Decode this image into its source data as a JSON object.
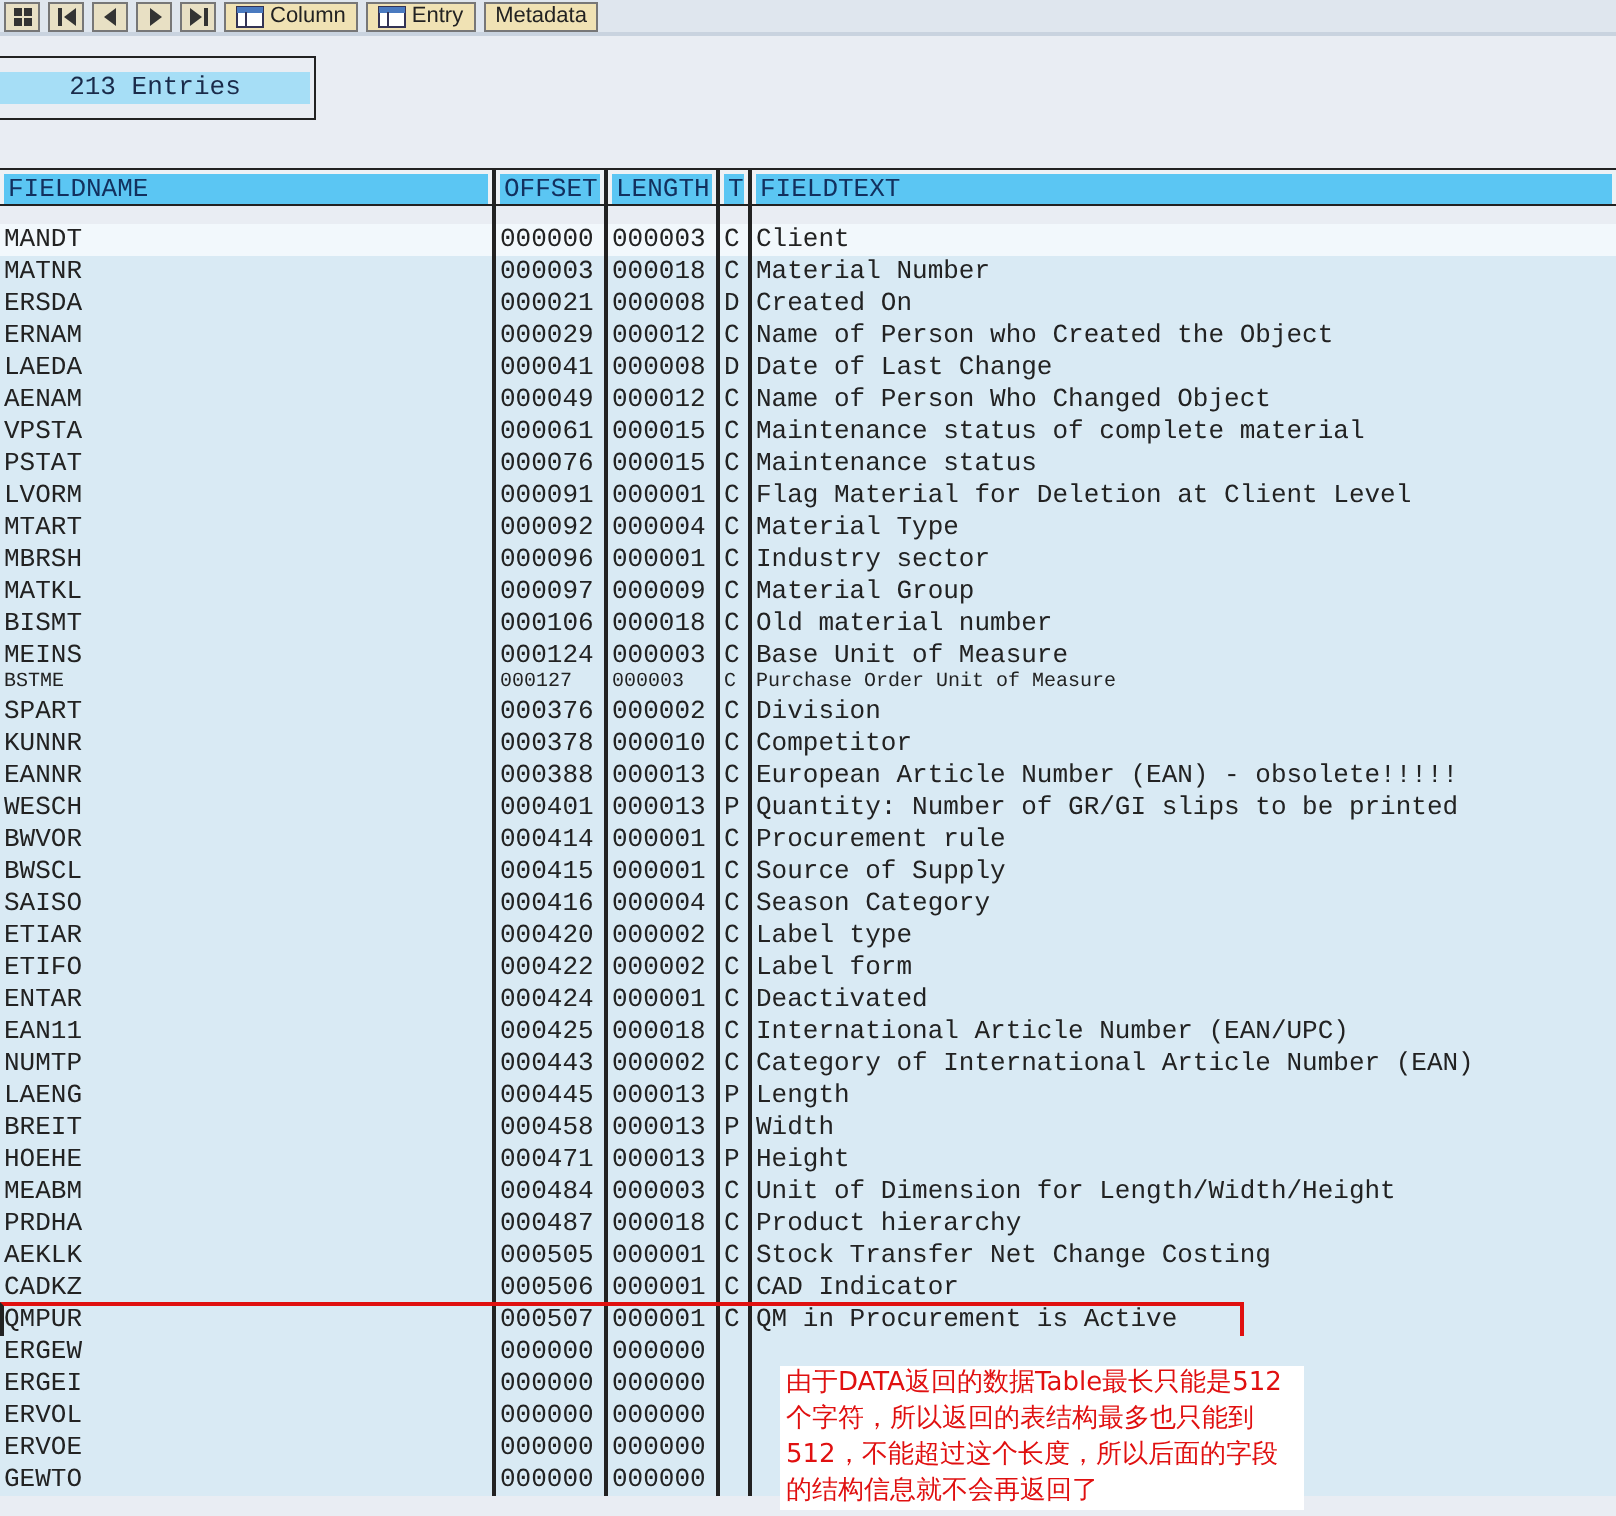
{
  "toolbar": {
    "nav_buttons": [
      {
        "kind": "grid"
      },
      {
        "kind": "first"
      },
      {
        "kind": "prev"
      },
      {
        "kind": "next"
      },
      {
        "kind": "last"
      }
    ],
    "buttons": [
      {
        "label": "Column",
        "icon": true
      },
      {
        "label": "Entry",
        "icon": true
      },
      {
        "label": "Metadata",
        "icon": false
      }
    ]
  },
  "entries_count": "213 Entries",
  "table": {
    "columns": [
      "FIELDNAME",
      "OFFSET",
      "LENGTH",
      "T",
      "FIELDTEXT"
    ],
    "rows": [
      {
        "cells": [
          "MANDT",
          "000000",
          "000003",
          "C",
          "Client"
        ],
        "selected": true,
        "highlighted": false,
        "clipped": false
      },
      {
        "cells": [
          "MATNR",
          "000003",
          "000018",
          "C",
          "Material Number"
        ],
        "selected": false,
        "highlighted": false,
        "clipped": false
      },
      {
        "cells": [
          "ERSDA",
          "000021",
          "000008",
          "D",
          "Created On"
        ],
        "selected": false,
        "highlighted": false,
        "clipped": false
      },
      {
        "cells": [
          "ERNAM",
          "000029",
          "000012",
          "C",
          "Name of Person who Created the Object"
        ],
        "selected": false,
        "highlighted": false,
        "clipped": false
      },
      {
        "cells": [
          "LAEDA",
          "000041",
          "000008",
          "D",
          "Date of Last Change"
        ],
        "selected": false,
        "highlighted": false,
        "clipped": false
      },
      {
        "cells": [
          "AENAM",
          "000049",
          "000012",
          "C",
          "Name of Person Who Changed Object"
        ],
        "selected": false,
        "highlighted": false,
        "clipped": false
      },
      {
        "cells": [
          "VPSTA",
          "000061",
          "000015",
          "C",
          "Maintenance status of complete material"
        ],
        "selected": false,
        "highlighted": false,
        "clipped": false
      },
      {
        "cells": [
          "PSTAT",
          "000076",
          "000015",
          "C",
          "Maintenance status"
        ],
        "selected": false,
        "highlighted": false,
        "clipped": false
      },
      {
        "cells": [
          "LVORM",
          "000091",
          "000001",
          "C",
          "Flag Material for Deletion at Client Level"
        ],
        "selected": false,
        "highlighted": false,
        "clipped": false
      },
      {
        "cells": [
          "MTART",
          "000092",
          "000004",
          "C",
          "Material Type"
        ],
        "selected": false,
        "highlighted": false,
        "clipped": false
      },
      {
        "cells": [
          "MBRSH",
          "000096",
          "000001",
          "C",
          "Industry sector"
        ],
        "selected": false,
        "highlighted": false,
        "clipped": false
      },
      {
        "cells": [
          "MATKL",
          "000097",
          "000009",
          "C",
          "Material Group"
        ],
        "selected": false,
        "highlighted": false,
        "clipped": false
      },
      {
        "cells": [
          "BISMT",
          "000106",
          "000018",
          "C",
          "Old material number"
        ],
        "selected": false,
        "highlighted": false,
        "clipped": false
      },
      {
        "cells": [
          "MEINS",
          "000124",
          "000003",
          "C",
          "Base Unit of Measure"
        ],
        "selected": false,
        "highlighted": false,
        "clipped": false
      },
      {
        "cells": [
          "BSTME",
          "000127",
          "000003",
          "C",
          "Purchase Order Unit of Measure"
        ],
        "selected": false,
        "highlighted": false,
        "clipped": true
      },
      {
        "cells": [
          "SPART",
          "000376",
          "000002",
          "C",
          "Division"
        ],
        "selected": false,
        "highlighted": false,
        "clipped": false
      },
      {
        "cells": [
          "KUNNR",
          "000378",
          "000010",
          "C",
          "Competitor"
        ],
        "selected": false,
        "highlighted": false,
        "clipped": false
      },
      {
        "cells": [
          "EANNR",
          "000388",
          "000013",
          "C",
          "European Article Number (EAN) - obsolete!!!!!"
        ],
        "selected": false,
        "highlighted": false,
        "clipped": false
      },
      {
        "cells": [
          "WESCH",
          "000401",
          "000013",
          "P",
          "Quantity: Number of GR/GI slips to be printed"
        ],
        "selected": false,
        "highlighted": false,
        "clipped": false
      },
      {
        "cells": [
          "BWVOR",
          "000414",
          "000001",
          "C",
          "Procurement rule"
        ],
        "selected": false,
        "highlighted": false,
        "clipped": false
      },
      {
        "cells": [
          "BWSCL",
          "000415",
          "000001",
          "C",
          "Source of Supply"
        ],
        "selected": false,
        "highlighted": false,
        "clipped": false
      },
      {
        "cells": [
          "SAISO",
          "000416",
          "000004",
          "C",
          "Season Category"
        ],
        "selected": false,
        "highlighted": false,
        "clipped": false
      },
      {
        "cells": [
          "ETIAR",
          "000420",
          "000002",
          "C",
          "Label type"
        ],
        "selected": false,
        "highlighted": false,
        "clipped": false
      },
      {
        "cells": [
          "ETIFO",
          "000422",
          "000002",
          "C",
          "Label form"
        ],
        "selected": false,
        "highlighted": false,
        "clipped": false
      },
      {
        "cells": [
          "ENTAR",
          "000424",
          "000001",
          "C",
          "Deactivated"
        ],
        "selected": false,
        "highlighted": false,
        "clipped": false
      },
      {
        "cells": [
          "EAN11",
          "000425",
          "000018",
          "C",
          "International Article Number (EAN/UPC)"
        ],
        "selected": false,
        "highlighted": false,
        "clipped": false
      },
      {
        "cells": [
          "NUMTP",
          "000443",
          "000002",
          "C",
          "Category of International Article Number (EAN)"
        ],
        "selected": false,
        "highlighted": false,
        "clipped": false
      },
      {
        "cells": [
          "LAENG",
          "000445",
          "000013",
          "P",
          "Length"
        ],
        "selected": false,
        "highlighted": false,
        "clipped": false
      },
      {
        "cells": [
          "BREIT",
          "000458",
          "000013",
          "P",
          "Width"
        ],
        "selected": false,
        "highlighted": false,
        "clipped": false
      },
      {
        "cells": [
          "HOEHE",
          "000471",
          "000013",
          "P",
          "Height"
        ],
        "selected": false,
        "highlighted": false,
        "clipped": false
      },
      {
        "cells": [
          "MEABM",
          "000484",
          "000003",
          "C",
          "Unit of Dimension for Length/Width/Height"
        ],
        "selected": false,
        "highlighted": false,
        "clipped": false
      },
      {
        "cells": [
          "PRDHA",
          "000487",
          "000018",
          "C",
          "Product hierarchy"
        ],
        "selected": false,
        "highlighted": false,
        "clipped": false
      },
      {
        "cells": [
          "AEKLK",
          "000505",
          "000001",
          "C",
          "Stock Transfer Net Change Costing"
        ],
        "selected": false,
        "highlighted": false,
        "clipped": false
      },
      {
        "cells": [
          "CADKZ",
          "000506",
          "000001",
          "C",
          "CAD Indicator"
        ],
        "selected": false,
        "highlighted": false,
        "clipped": false
      },
      {
        "cells": [
          "QMPUR",
          "000507",
          "000001",
          "C",
          "QM in Procurement is Active"
        ],
        "selected": false,
        "highlighted": true,
        "clipped": false
      },
      {
        "cells": [
          "ERGEW",
          "000000",
          "000000"
        ],
        "selected": false,
        "highlighted": false,
        "clipped": false
      },
      {
        "cells": [
          "ERGEI",
          "000000",
          "000000"
        ],
        "selected": false,
        "highlighted": false,
        "clipped": false
      },
      {
        "cells": [
          "ERVOL",
          "000000",
          "000000"
        ],
        "selected": false,
        "highlighted": false,
        "clipped": false
      },
      {
        "cells": [
          "ERVOE",
          "000000",
          "000000"
        ],
        "selected": false,
        "highlighted": false,
        "clipped": false
      },
      {
        "cells": [
          "GEWTO",
          "000000",
          "000000"
        ],
        "selected": false,
        "highlighted": false,
        "clipped": false
      }
    ]
  },
  "annotation": "由于DATA返回的数据Table最长只能是512个字符，所以返回的表结构最多也只能到512，不能超过这个长度，所以后面的字段的结构信息就不会再返回了"
}
